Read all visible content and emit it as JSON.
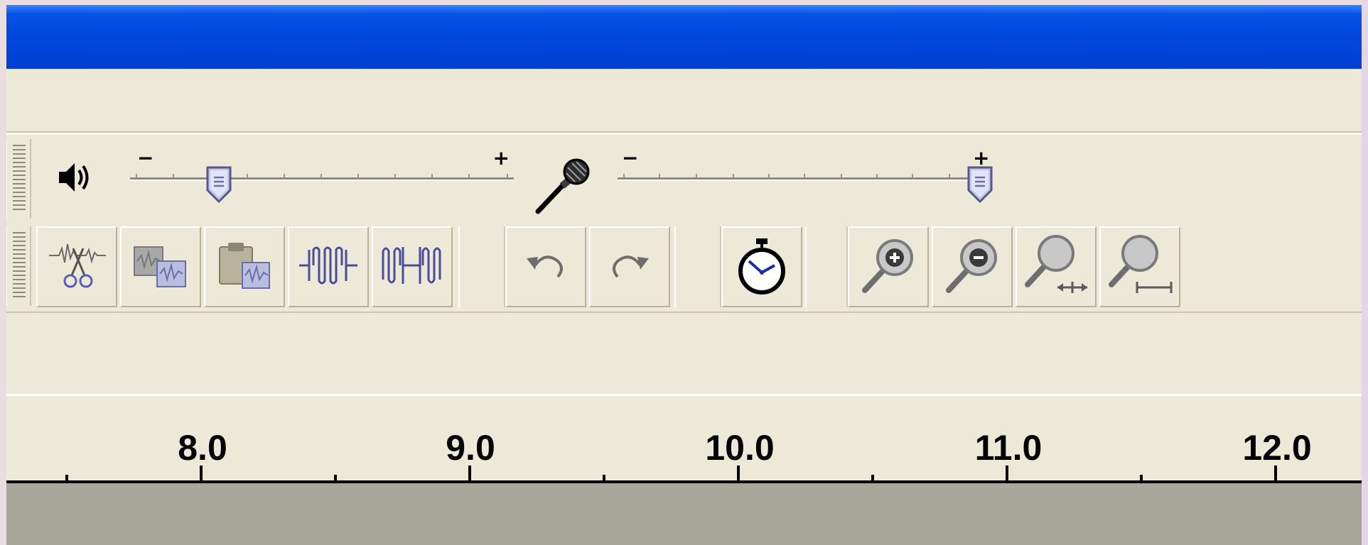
{
  "window": {
    "title_bar_color": "#0048e0",
    "face_color": "#ece9d8",
    "track_area_color": "#a8a698"
  },
  "mixer": {
    "playback": {
      "icon": "speaker-icon",
      "minus": "−",
      "plus": "+",
      "level": 0.22
    },
    "recording": {
      "icon": "microphone-icon",
      "minus": "−",
      "plus": "+",
      "level": 1.0
    }
  },
  "edit_toolbar": {
    "buttons": [
      {
        "icon": "trim-icon"
      },
      {
        "icon": "copy-icon"
      },
      {
        "icon": "paste-icon"
      },
      {
        "icon": "trim-outside-icon"
      },
      {
        "icon": "silence-icon"
      },
      {
        "icon": "undo-icon"
      },
      {
        "icon": "redo-icon"
      },
      {
        "icon": "sync-lock-icon"
      },
      {
        "icon": "zoom-in-icon"
      },
      {
        "icon": "zoom-out-icon"
      },
      {
        "icon": "fit-selection-icon"
      },
      {
        "icon": "fit-project-icon"
      }
    ]
  },
  "timeline": {
    "labels": [
      "8.0",
      "9.0",
      "10.0",
      "11.0",
      "12.0"
    ]
  }
}
